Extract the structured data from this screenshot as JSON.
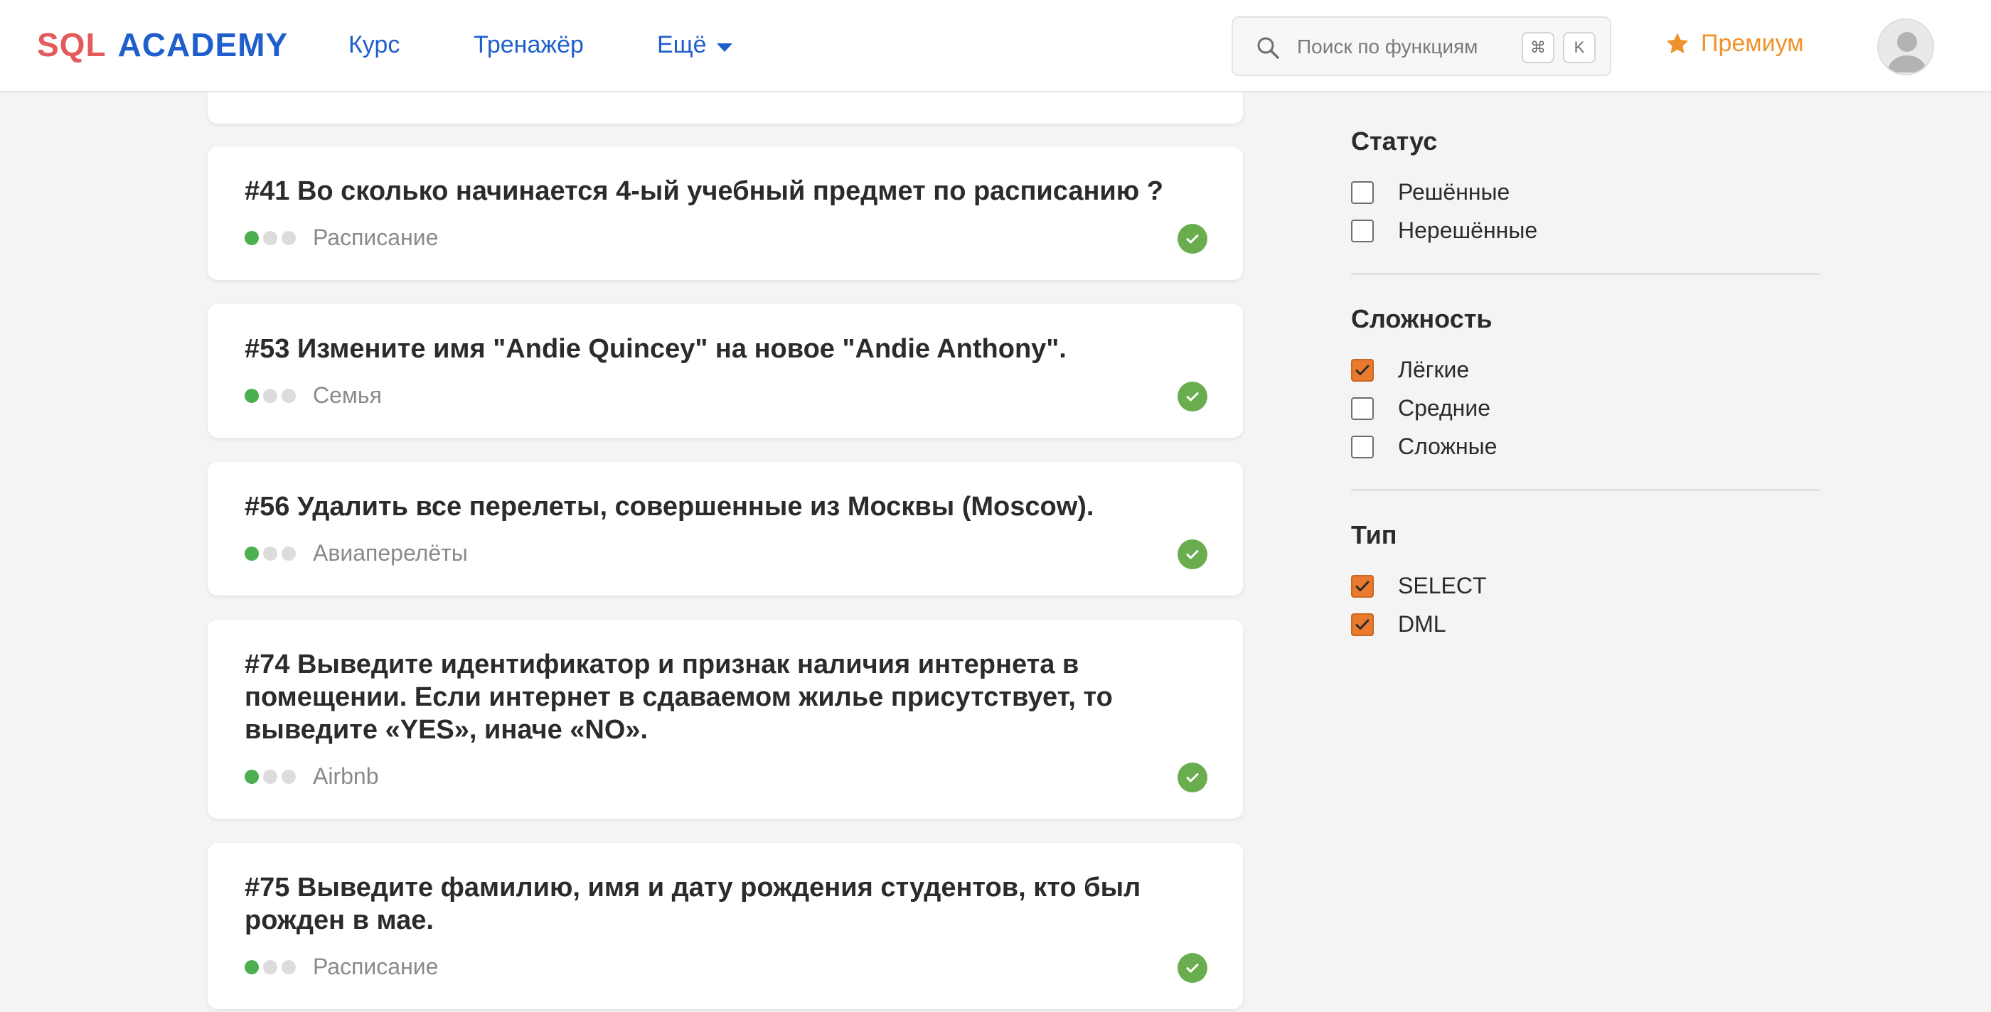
{
  "header": {
    "logo_sql": "SQL",
    "logo_academy": "ACADEMY",
    "nav": {
      "course": "Курс",
      "trainer": "Тренажёр",
      "more": "Ещё"
    },
    "search": {
      "placeholder": "Поиск по функциям",
      "shortcut_cmd": "⌘",
      "shortcut_key": "K"
    },
    "premium_label": "Премиум",
    "accent_color": "#1f5fcc",
    "premium_color": "#f0922b"
  },
  "problems": [
    {
      "title": "#41 Во сколько начинается 4-ый учебный предмет по расписанию ?",
      "tag": "Расписание",
      "difficulty_level": 1,
      "solved": true
    },
    {
      "title": "#53 Измените имя \"Andie Quincey\" на новое \"Andie Anthony\".",
      "tag": "Семья",
      "difficulty_level": 1,
      "solved": true
    },
    {
      "title": "#56 Удалить все перелеты, совершенные из Москвы (Moscow).",
      "tag": "Авиаперелёты",
      "difficulty_level": 1,
      "solved": true
    },
    {
      "title": "#74 Выведите идентификатор и признак наличия интернета в помещении. Если интернет в сдаваемом жилье присутствует, то выведите «YES», иначе «NO».",
      "tag": "Airbnb",
      "difficulty_level": 1,
      "solved": true
    },
    {
      "title": "#75 Выведите фамилию, имя и дату рождения студентов, кто был рожден в мае.",
      "tag": "Расписание",
      "difficulty_level": 1,
      "solved": true
    }
  ],
  "filters": {
    "status": {
      "heading": "Статус",
      "options": [
        {
          "label": "Решённые",
          "checked": false
        },
        {
          "label": "Нерешённые",
          "checked": false
        }
      ]
    },
    "difficulty": {
      "heading": "Сложность",
      "options": [
        {
          "label": "Лёгкие",
          "checked": true
        },
        {
          "label": "Средние",
          "checked": false
        },
        {
          "label": "Сложные",
          "checked": false
        }
      ]
    },
    "type": {
      "heading": "Тип",
      "options": [
        {
          "label": "SELECT",
          "checked": true
        },
        {
          "label": "DML",
          "checked": true
        }
      ]
    },
    "checked_color": "#ea7a2e"
  },
  "icons": {
    "search": "search-icon",
    "caret": "chevron-down-icon",
    "star": "star-icon",
    "avatar": "user-avatar-icon",
    "solved": "check-circle-icon"
  }
}
